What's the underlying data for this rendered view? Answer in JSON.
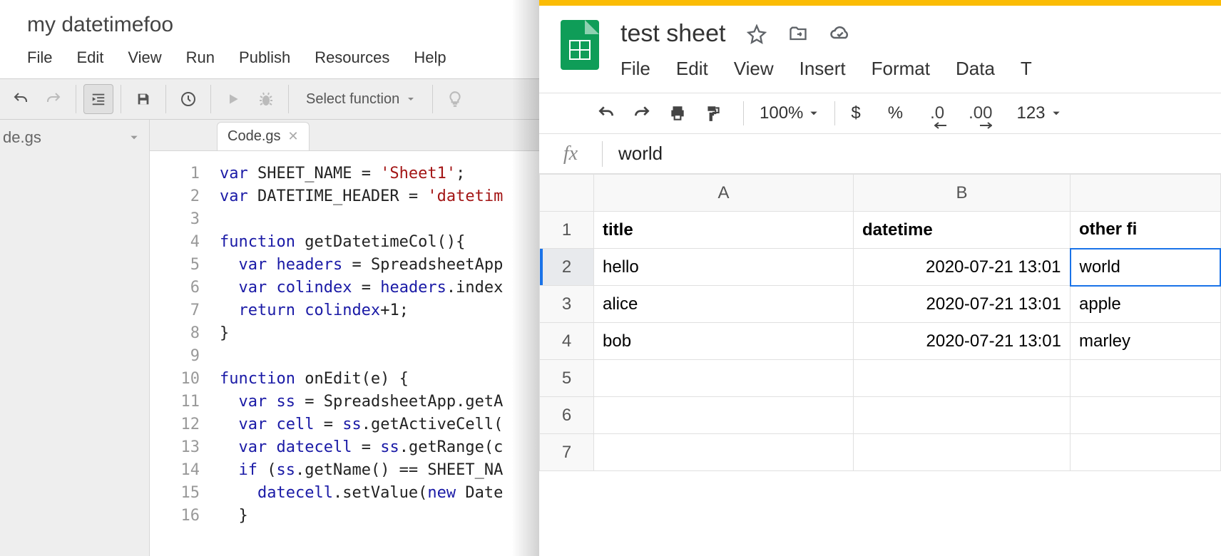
{
  "ide": {
    "title": "my datetimefoo",
    "menu": {
      "file": "File",
      "edit": "Edit",
      "view": "View",
      "run": "Run",
      "publish": "Publish",
      "resources": "Resources",
      "help": "Help"
    },
    "select_fn": "Select function",
    "sidebar_file": "de.gs",
    "tab": "Code.gs",
    "code": {
      "lines": [
        "1",
        "2",
        "3",
        "4",
        "5",
        "6",
        "7",
        "8",
        "9",
        "10",
        "11",
        "12",
        "13",
        "14",
        "15",
        "16"
      ],
      "l1_a": "var",
      "l1_b": " SHEET_NAME = ",
      "l1_c": "'Sheet1'",
      "l1_d": ";",
      "l2_a": "var",
      "l2_b": " DATETIME_HEADER = ",
      "l2_c": "'datetim",
      "l4_a": "function",
      "l4_b": " getDatetimeCol(){",
      "l5_a": "  var",
      "l5_b": " headers",
      "l5_c": " = SpreadsheetApp",
      "l6_a": "  var",
      "l6_b": " colindex",
      "l6_c": " = ",
      "l6_d": "headers",
      "l6_e": ".index",
      "l7_a": "  return",
      "l7_b": " colindex",
      "l7_c": "+",
      "l7_d": "1",
      "l7_e": ";",
      "l8": "}",
      "l10_a": "function",
      "l10_b": " onEdit(e) {",
      "l11_a": "  var",
      "l11_b": " ss",
      "l11_c": " = SpreadsheetApp.getA",
      "l12_a": "  var",
      "l12_b": " cell",
      "l12_c": " = ",
      "l12_d": "ss",
      "l12_e": ".getActiveCell(",
      "l13_a": "  var",
      "l13_b": " datecell",
      "l13_c": " = ",
      "l13_d": "ss",
      "l13_e": ".getRange(c",
      "l14_a": "  if",
      "l14_b": " (",
      "l14_c": "ss",
      "l14_d": ".getName() == SHEET_NA",
      "l15_a": "    datecell",
      "l15_b": ".setValue(",
      "l15_c": "new",
      "l15_d": " Date",
      "l16": "  }"
    }
  },
  "sheets": {
    "title": "test sheet",
    "menu": {
      "file": "File",
      "edit": "Edit",
      "view": "View",
      "insert": "Insert",
      "format": "Format",
      "data": "Data",
      "t": "T"
    },
    "toolbar": {
      "zoom": "100%",
      "dollar": "$",
      "percent": "%",
      "dec1": ".0",
      "dec2": ".00",
      "num": "123"
    },
    "fx_value": "world",
    "cols": {
      "A": "A",
      "B": "B"
    },
    "rows": {
      "1": "1",
      "2": "2",
      "3": "3",
      "4": "4",
      "5": "5",
      "6": "6",
      "7": "7"
    },
    "data": {
      "h_title": "title",
      "h_dt": "datetime",
      "h_other": "other fi",
      "r2a": "hello",
      "r2b": "2020-07-21 13:01",
      "r2c": "world",
      "r3a": "alice",
      "r3b": "2020-07-21 13:01",
      "r3c": "apple",
      "r4a": "bob",
      "r4b": "2020-07-21 13:01",
      "r4c": "marley"
    }
  }
}
